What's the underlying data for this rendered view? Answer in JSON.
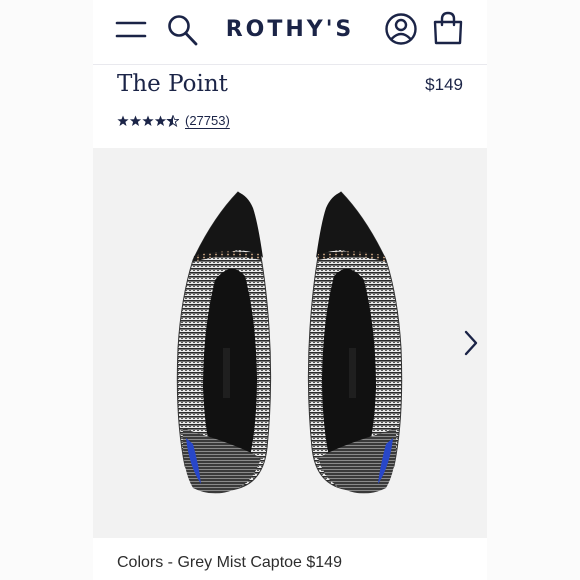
{
  "header": {
    "logo": "ROTHY'S",
    "menu_icon": "hamburger-menu-icon",
    "search_icon": "search-icon",
    "account_icon": "account-icon",
    "bag_icon": "shopping-bag-icon"
  },
  "product": {
    "title": "The Point",
    "price": "$149",
    "rating": 4.5,
    "rating_max": 5,
    "review_count": "(27753)"
  },
  "gallery": {
    "next_icon": "chevron-right-icon"
  },
  "caption": {
    "text": "Colors - Grey Mist Captoe $149"
  },
  "colors": {
    "brand_navy": "#1b2447",
    "background": "#f2f2f2",
    "accent_blue": "#2847c9"
  }
}
